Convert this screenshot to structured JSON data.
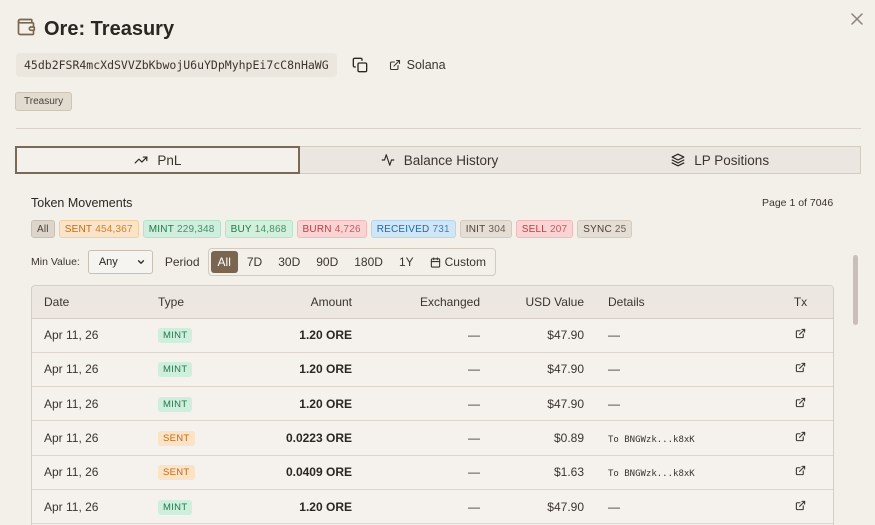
{
  "header": {
    "title": "Ore: Treasury",
    "address": "45db2FSR4mcXdSVVZbKbwojU6uYDpMyhpEi7cC8nHaWG",
    "chain": "Solana",
    "tag": "Treasury"
  },
  "tabs": [
    {
      "label": "PnL",
      "icon": "trending-up-icon",
      "active": true
    },
    {
      "label": "Balance History",
      "icon": "activity-icon",
      "active": false
    },
    {
      "label": "LP Positions",
      "icon": "layers-icon",
      "active": false
    }
  ],
  "movements": {
    "title": "Token Movements",
    "page_info": "Page 1 of 7046",
    "chips": [
      {
        "label": "All",
        "count": "",
        "bg": "#dcd5cb",
        "fg": "#4a423a",
        "border": "#c9bfb2"
      },
      {
        "label": "SENT",
        "count": "454,367",
        "bg": "#fae3c6",
        "fg": "#c26a13",
        "border": "#f3cf9f"
      },
      {
        "label": "MINT",
        "count": "229,348",
        "bg": "#cfeedd",
        "fg": "#1f7a4a",
        "border": "#b3e2c8"
      },
      {
        "label": "BUY",
        "count": "14,868",
        "bg": "#d3f0dc",
        "fg": "#1f7a4a",
        "border": "#b7e4c6"
      },
      {
        "label": "BURN",
        "count": "4,726",
        "bg": "#fad4d4",
        "fg": "#c23b3b",
        "border": "#f2b9b9"
      },
      {
        "label": "RECEIVED",
        "count": "731",
        "bg": "#cfe6f7",
        "fg": "#1f6aa8",
        "border": "#b4d6ef"
      },
      {
        "label": "INIT",
        "count": "304",
        "bg": "#e4ded4",
        "fg": "#4a423a",
        "border": "#d3cbbf"
      },
      {
        "label": "SELL",
        "count": "207",
        "bg": "#fad4d4",
        "fg": "#c23b3b",
        "border": "#f2b9b9"
      },
      {
        "label": "SYNC",
        "count": "25",
        "bg": "#e4ded4",
        "fg": "#4a423a",
        "border": "#d3cbbf"
      }
    ]
  },
  "filters": {
    "min_value_label": "Min Value:",
    "min_value": "Any",
    "period_label": "Period",
    "periods": [
      "All",
      "7D",
      "30D",
      "90D",
      "180D",
      "1Y"
    ],
    "active_period": "All",
    "custom_label": "Custom"
  },
  "table": {
    "columns": [
      "Date",
      "Type",
      "Amount",
      "Exchanged",
      "USD Value",
      "Details",
      "Tx"
    ],
    "type_colors": {
      "MINT": {
        "bg": "#cfeedd",
        "fg": "#1f7a4a"
      },
      "SENT": {
        "bg": "#fae3c6",
        "fg": "#c26a13"
      }
    },
    "rows": [
      {
        "date": "Apr 11, 26",
        "type": "MINT",
        "amount": "1.20 ORE",
        "exchanged": "—",
        "usd": "$47.90",
        "details": "—"
      },
      {
        "date": "Apr 11, 26",
        "type": "MINT",
        "amount": "1.20 ORE",
        "exchanged": "—",
        "usd": "$47.90",
        "details": "—"
      },
      {
        "date": "Apr 11, 26",
        "type": "MINT",
        "amount": "1.20 ORE",
        "exchanged": "—",
        "usd": "$47.90",
        "details": "—"
      },
      {
        "date": "Apr 11, 26",
        "type": "SENT",
        "amount": "0.0223 ORE",
        "exchanged": "—",
        "usd": "$0.89",
        "details": "To BNGWzk...k8xK"
      },
      {
        "date": "Apr 11, 26",
        "type": "SENT",
        "amount": "0.0409 ORE",
        "exchanged": "—",
        "usd": "$1.63",
        "details": "To BNGWzk...k8xK"
      },
      {
        "date": "Apr 11, 26",
        "type": "MINT",
        "amount": "1.20 ORE",
        "exchanged": "—",
        "usd": "$47.90",
        "details": "—"
      }
    ]
  }
}
